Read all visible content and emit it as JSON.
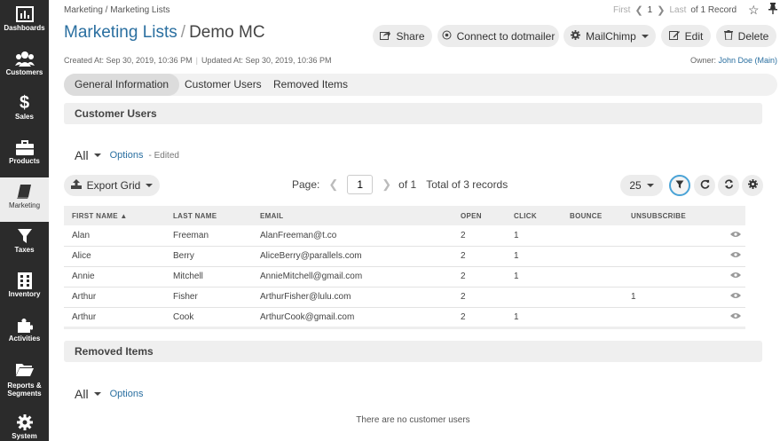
{
  "sidebar": {
    "items": [
      {
        "label": "Dashboards",
        "icon": "dashboards-icon"
      },
      {
        "label": "Customers",
        "icon": "customers-icon"
      },
      {
        "label": "Sales",
        "icon": "dollar-icon"
      },
      {
        "label": "Products",
        "icon": "briefcase-icon"
      },
      {
        "label": "Marketing",
        "icon": "book-icon"
      },
      {
        "label": "Taxes",
        "icon": "filter-icon"
      },
      {
        "label": "Inventory",
        "icon": "inventory-icon"
      },
      {
        "label": "Activities",
        "icon": "puzzle-icon"
      },
      {
        "label": "Reports &",
        "label2": "Segments",
        "icon": "folder-icon"
      },
      {
        "label": "System",
        "icon": "gear-icon"
      }
    ]
  },
  "breadcrumb": "Marketing / Marketing Lists",
  "record_pager": {
    "first": "First",
    "current": "1",
    "last": "Last",
    "of": "of 1 Record"
  },
  "title": {
    "section": "Marketing Lists",
    "separator": "/",
    "record": "Demo MC"
  },
  "actions": {
    "share": "Share",
    "connect": "Connect to dotmailer",
    "mailchimp": "MailChimp",
    "edit": "Edit",
    "delete": "Delete"
  },
  "meta": {
    "created": "Created At: Sep 30, 2019, 10:36 PM",
    "updated": "Updated At: Sep 30, 2019, 10:36 PM",
    "owner_label": "Owner:",
    "owner_name": "John Doe (Main)"
  },
  "tabs": [
    "General Information",
    "Customer Users",
    "Removed Items"
  ],
  "customer_users": {
    "heading": "Customer Users",
    "view": "All",
    "options": "Options",
    "edited": "- Edited",
    "export": "Export Grid",
    "page_label": "Page:",
    "page_value": "1",
    "of_pages": "of 1",
    "total": "Total of 3 records",
    "per_page": "25",
    "columns": [
      "FIRST NAME",
      "LAST NAME",
      "EMAIL",
      "OPEN",
      "CLICK",
      "BOUNCE",
      "UNSUBSCRIBE"
    ],
    "sort_indicator": "▲",
    "rows": [
      [
        "Alan",
        "Freeman",
        "AlanFreeman@t.co",
        "2",
        "1",
        "",
        ""
      ],
      [
        "Alice",
        "Berry",
        "AliceBerry@parallels.com",
        "2",
        "1",
        "",
        ""
      ],
      [
        "Annie",
        "Mitchell",
        "AnnieMitchell@gmail.com",
        "2",
        "1",
        "",
        ""
      ],
      [
        "Arthur",
        "Fisher",
        "ArthurFisher@lulu.com",
        "2",
        "",
        "",
        "1"
      ],
      [
        "Arthur",
        "Cook",
        "ArthurCook@gmail.com",
        "2",
        "1",
        "",
        ""
      ]
    ]
  },
  "removed_items": {
    "heading": "Removed Items",
    "view": "All",
    "options": "Options",
    "empty": "There are no customer users"
  },
  "colors": {
    "sidebar": "#2b2b2b",
    "link": "#2a6fa0",
    "accent": "#4aa3d6"
  }
}
